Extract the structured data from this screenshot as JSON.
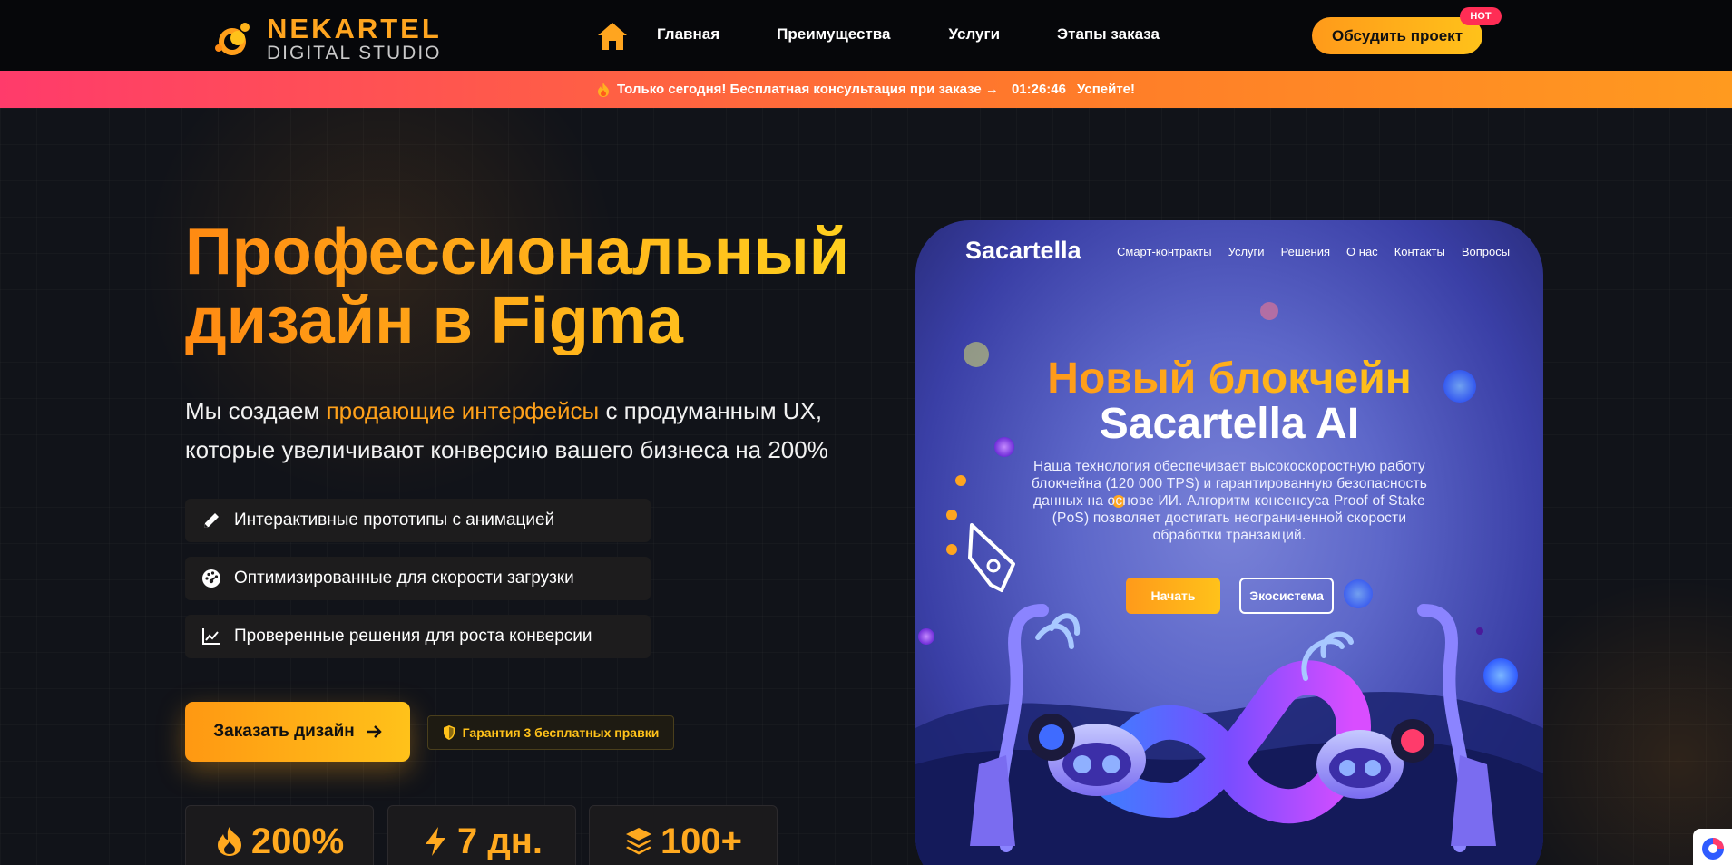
{
  "header": {
    "logo_name": "NEKARTEL",
    "logo_sub": "DIGITAL STUDIO",
    "nav": [
      "Главная",
      "Преимущества",
      "Услуги",
      "Этапы заказа"
    ],
    "cta": "Обсудить проект",
    "hot_badge": "HOT"
  },
  "promo": {
    "text": "Только сегодня! Бесплатная консультация при заказе →",
    "timer": "01:26:46",
    "hurry": "Успейте!"
  },
  "hero": {
    "title_line1": "Профессиональный",
    "title_line2": "дизайн в Figma",
    "lead_before": "Мы создаем ",
    "lead_highlight": "продающие интерфейсы",
    "lead_after": " с продуманным UX,",
    "lead_line2": "которые увеличивают конверсию вашего бизнеса на 200%",
    "features": [
      {
        "label": "Интерактивные прототипы с анимацией",
        "icon": "pencil-icon"
      },
      {
        "label": "Оптимизированные для скорости загрузки",
        "icon": "gauge-icon"
      },
      {
        "label": "Проверенные решения для роста конверсии",
        "icon": "chart-line-icon"
      }
    ],
    "order_button": "Заказать дизайн",
    "guarantee": "Гарантия 3 бесплатных правки",
    "stats": [
      {
        "value": "200%",
        "icon": "fire-icon"
      },
      {
        "value": "7 дн.",
        "icon": "bolt-icon"
      },
      {
        "value": "100+",
        "icon": "layers-icon"
      }
    ]
  },
  "mockup": {
    "logo": "Sacartella",
    "nav": [
      "Смарт-контракты",
      "Услуги",
      "Решения",
      "О нас",
      "Контакты",
      "Вопросы"
    ],
    "heading_line1": "Новый блокчейн",
    "heading_line2": "Sacartella AI",
    "paragraph": "Наша технология обеспечивает высокоскоростную работу блокчейна (120 000 TPS) и гарантированную безопасность данных на основе ИИ. Алгоритм консенсуса Proof of Stake (PoS) позволяет достигать неограниченной скорости обработки транзакций.",
    "button_primary": "Начать",
    "button_secondary": "Экосистема"
  },
  "colors": {
    "accent": "#ffa51f",
    "accent_light": "#ffc21a",
    "hot": "#ff2d55",
    "promo_start": "#ff3b6b",
    "promo_end": "#ff9a1f",
    "background": "#111319",
    "mock_bg": "#5d67c9"
  }
}
